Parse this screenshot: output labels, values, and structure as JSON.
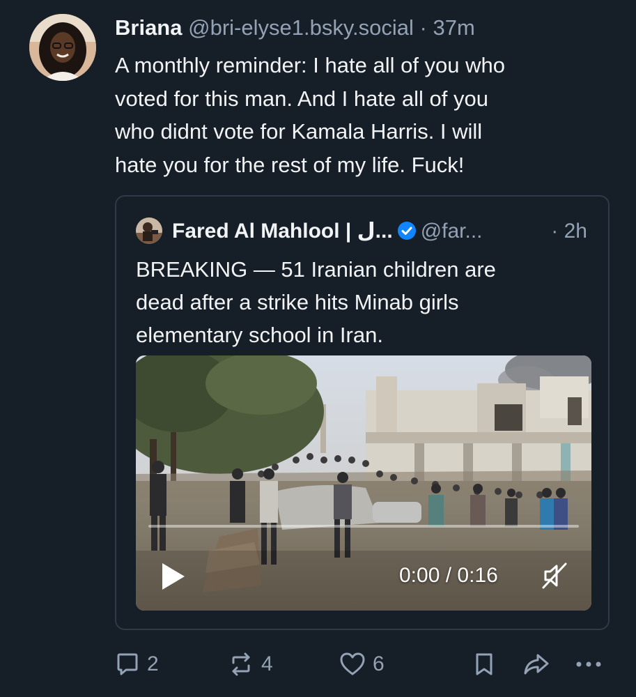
{
  "post": {
    "author_name": "Briana",
    "author_handle": "@bri-elyse1.bsky.social",
    "separator": "·",
    "time": "37m",
    "text_lines": [
      "A monthly reminder: I hate all of you who",
      "voted for this man. And I hate all of you",
      "who didnt vote for Kamala Harris. I will",
      "hate you for the rest of my life. Fuck!"
    ]
  },
  "quote": {
    "author_name": "Fared Al Mahlool | ل...",
    "verified_icon": "verified-badge-icon",
    "author_handle": "@far...",
    "separator": "·",
    "time": "2h",
    "text_lines": [
      "BREAKING — 51 Iranian children are",
      "dead after a strike hits Minab girls",
      "elementary school in Iran."
    ],
    "video": {
      "time_display": "0:00 / 0:16",
      "progress": 0,
      "play_icon": "play-icon",
      "mute_icon": "muted-speaker-icon"
    }
  },
  "actions": {
    "reply_count": "2",
    "repost_count": "4",
    "like_count": "6",
    "icons": [
      "reply-icon",
      "repost-icon",
      "like-icon",
      "bookmark-icon",
      "share-icon",
      "more-icon"
    ]
  },
  "colors": {
    "background": "#161e27",
    "text": "#f1f3f5",
    "muted": "#93a2b4",
    "border": "#2e3a47",
    "verified": "#1185fe"
  }
}
